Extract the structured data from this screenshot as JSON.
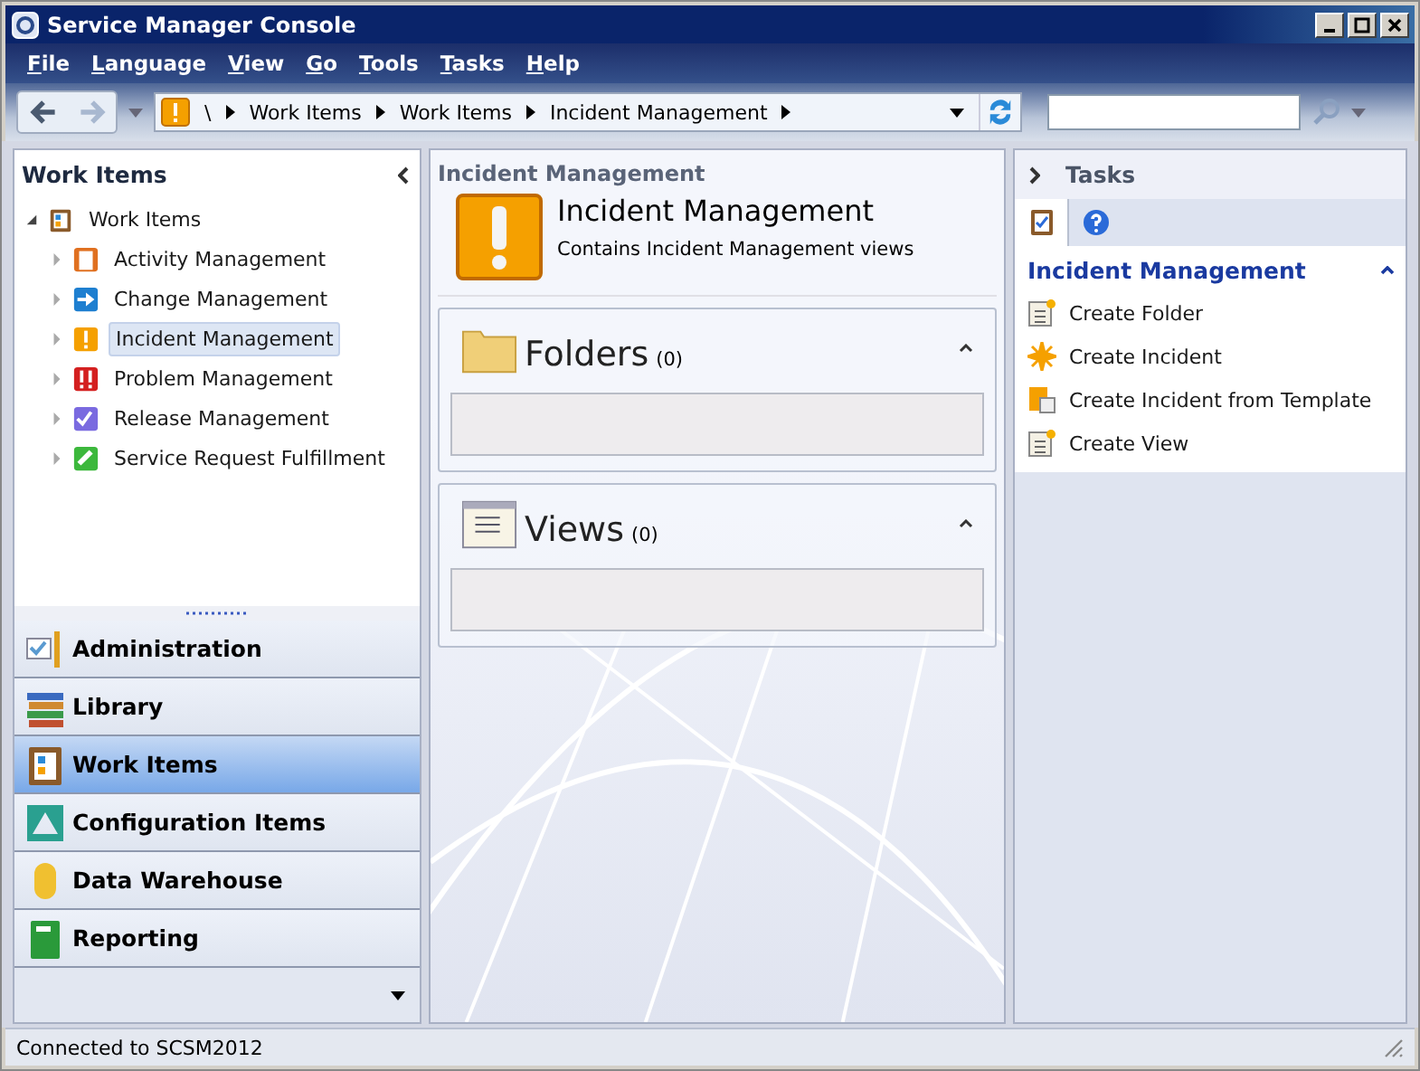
{
  "window": {
    "title": "Service Manager Console"
  },
  "menu": [
    {
      "label": "File"
    },
    {
      "label": "Language"
    },
    {
      "label": "View"
    },
    {
      "label": "Go"
    },
    {
      "label": "Tools"
    },
    {
      "label": "Tasks"
    },
    {
      "label": "Help"
    }
  ],
  "breadcrumb": [
    "\\",
    "Work Items",
    "Work Items",
    "Incident Management"
  ],
  "navigation": {
    "title": "Work Items",
    "tree": [
      {
        "label": "Work Items",
        "kind": "workitems",
        "expanded": true,
        "selected": false,
        "children": [
          {
            "label": "Activity Management",
            "kind": "activity",
            "expanded": false,
            "selected": false
          },
          {
            "label": "Change Management",
            "kind": "change",
            "expanded": false,
            "selected": false
          },
          {
            "label": "Incident Management",
            "kind": "incident",
            "expanded": false,
            "selected": true
          },
          {
            "label": "Problem Management",
            "kind": "problem",
            "expanded": false,
            "selected": false
          },
          {
            "label": "Release Management",
            "kind": "release",
            "expanded": false,
            "selected": false
          },
          {
            "label": "Service Request Fulfillment",
            "kind": "service",
            "expanded": false,
            "selected": false
          }
        ]
      }
    ]
  },
  "workspaces": [
    {
      "label": "Administration",
      "kind": "admin",
      "selected": false
    },
    {
      "label": "Library",
      "kind": "library",
      "selected": false
    },
    {
      "label": "Work Items",
      "kind": "workitems",
      "selected": true
    },
    {
      "label": "Configuration Items",
      "kind": "config",
      "selected": false
    },
    {
      "label": "Data Warehouse",
      "kind": "warehouse",
      "selected": false
    },
    {
      "label": "Reporting",
      "kind": "reporting",
      "selected": false
    }
  ],
  "content": {
    "header": "Incident Management",
    "title": "Incident Management",
    "description": "Contains Incident Management views",
    "sections": [
      {
        "title": "Folders",
        "count": "(0)",
        "kind": "folder",
        "expanded": true
      },
      {
        "title": "Views",
        "count": "(0)",
        "kind": "views",
        "expanded": true
      }
    ]
  },
  "tasks": {
    "title": "Tasks",
    "tabs": [
      {
        "kind": "tasks",
        "selected": true
      },
      {
        "kind": "help",
        "selected": false
      }
    ],
    "group": {
      "title": "Incident Management",
      "expanded": true
    },
    "items": [
      {
        "label": "Create Folder",
        "kind": "new"
      },
      {
        "label": "Create Incident",
        "kind": "star"
      },
      {
        "label": "Create Incident from Template",
        "kind": "template"
      },
      {
        "label": "Create View",
        "kind": "new"
      }
    ]
  },
  "status_bar": "Connected to SCSM2012"
}
